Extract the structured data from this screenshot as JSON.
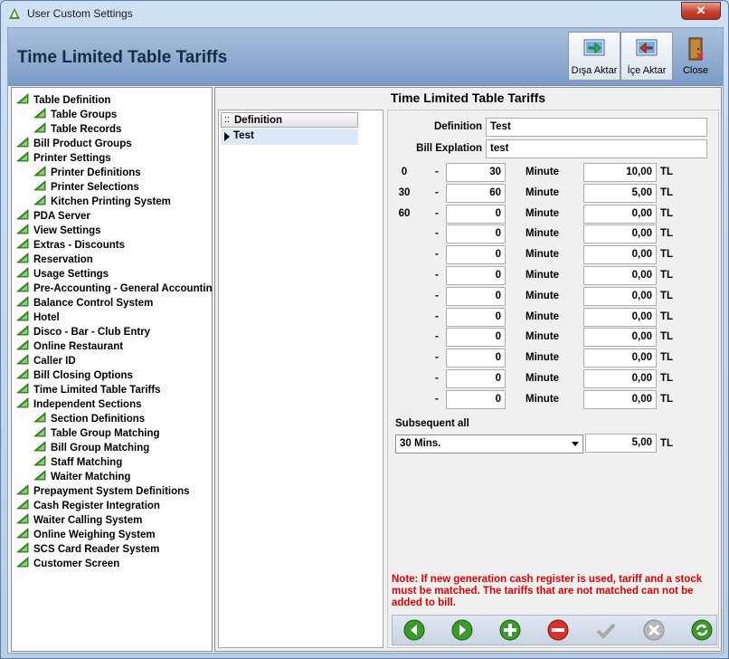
{
  "window": {
    "title": "User Custom Settings",
    "close_glyph": "✕"
  },
  "header": {
    "title": "Time Limited Table Tariffs"
  },
  "toolbar": {
    "export_label": "Dışa Aktar",
    "import_label": "İçe Aktar",
    "close_label": "Close"
  },
  "tree": [
    {
      "label": "Table Definition",
      "level": 0
    },
    {
      "label": "Table Groups",
      "level": 1
    },
    {
      "label": "Table Records",
      "level": 1
    },
    {
      "label": "Bill Product Groups",
      "level": 0
    },
    {
      "label": "Printer Settings",
      "level": 0
    },
    {
      "label": "Printer Definitions",
      "level": 1
    },
    {
      "label": "Printer Selections",
      "level": 1
    },
    {
      "label": "Kitchen Printing System",
      "level": 1
    },
    {
      "label": "PDA Server",
      "level": 0
    },
    {
      "label": "View Settings",
      "level": 0
    },
    {
      "label": "Extras - Discounts",
      "level": 0
    },
    {
      "label": "Reservation",
      "level": 0
    },
    {
      "label": "Usage Settings",
      "level": 0
    },
    {
      "label": "Pre-Accounting - General Accountin",
      "level": 0
    },
    {
      "label": "Balance Control System",
      "level": 0
    },
    {
      "label": "Hotel",
      "level": 0
    },
    {
      "label": "Disco - Bar - Club Entry",
      "level": 0
    },
    {
      "label": "Online Restaurant",
      "level": 0
    },
    {
      "label": "Caller ID",
      "level": 0
    },
    {
      "label": "Bill Closing Options",
      "level": 0
    },
    {
      "label": "Time Limited Table Tariffs",
      "level": 0
    },
    {
      "label": "Independent Sections",
      "level": 0
    },
    {
      "label": "Section Definitions",
      "level": 1
    },
    {
      "label": "Table Group Matching",
      "level": 1
    },
    {
      "label": "Bill Group Matching",
      "level": 1
    },
    {
      "label": "Staff Matching",
      "level": 1
    },
    {
      "label": "Waiter Matching",
      "level": 1
    },
    {
      "label": "Prepayment System Definitions",
      "level": 0
    },
    {
      "label": "Cash Register Integration",
      "level": 0
    },
    {
      "label": "Waiter Calling System",
      "level": 0
    },
    {
      "label": "Online Weighing System",
      "level": 0
    },
    {
      "label": "SCS Card Reader System",
      "level": 0
    },
    {
      "label": "Customer Screen",
      "level": 0
    }
  ],
  "panel": {
    "title": "Time Limited Table Tariffs"
  },
  "grid": {
    "dots": "::",
    "column": "Definition",
    "rows": [
      "Test"
    ]
  },
  "form": {
    "definition_label": "Definition",
    "definition_value": "Test",
    "bill_label": "Bill Explation",
    "bill_value": "test",
    "dash": "-",
    "unit_label": "Minute",
    "currency": "TL",
    "tiers": [
      {
        "start": "0",
        "minutes": "30",
        "price": "10,00"
      },
      {
        "start": "30",
        "minutes": "60",
        "price": "5,00"
      },
      {
        "start": "60",
        "minutes": "0",
        "price": "0,00"
      },
      {
        "start": "",
        "minutes": "0",
        "price": "0,00"
      },
      {
        "start": "",
        "minutes": "0",
        "price": "0,00"
      },
      {
        "start": "",
        "minutes": "0",
        "price": "0,00"
      },
      {
        "start": "",
        "minutes": "0",
        "price": "0,00"
      },
      {
        "start": "",
        "minutes": "0",
        "price": "0,00"
      },
      {
        "start": "",
        "minutes": "0",
        "price": "0,00"
      },
      {
        "start": "",
        "minutes": "0",
        "price": "0,00"
      },
      {
        "start": "",
        "minutes": "0",
        "price": "0,00"
      },
      {
        "start": "",
        "minutes": "0",
        "price": "0,00"
      }
    ],
    "subsequent_label": "Subsequent all",
    "subsequent_select": "30 Mins.",
    "subsequent_price": "5,00"
  },
  "note": "Note: If new generation cash register is used, tariff and a stock must be matched. The tariffs that are not matched can not be added to bill.",
  "colors": {
    "accent": "#7c9cc7",
    "note": "#e00000",
    "green": "#3a9a2a",
    "red": "#d9302a"
  }
}
